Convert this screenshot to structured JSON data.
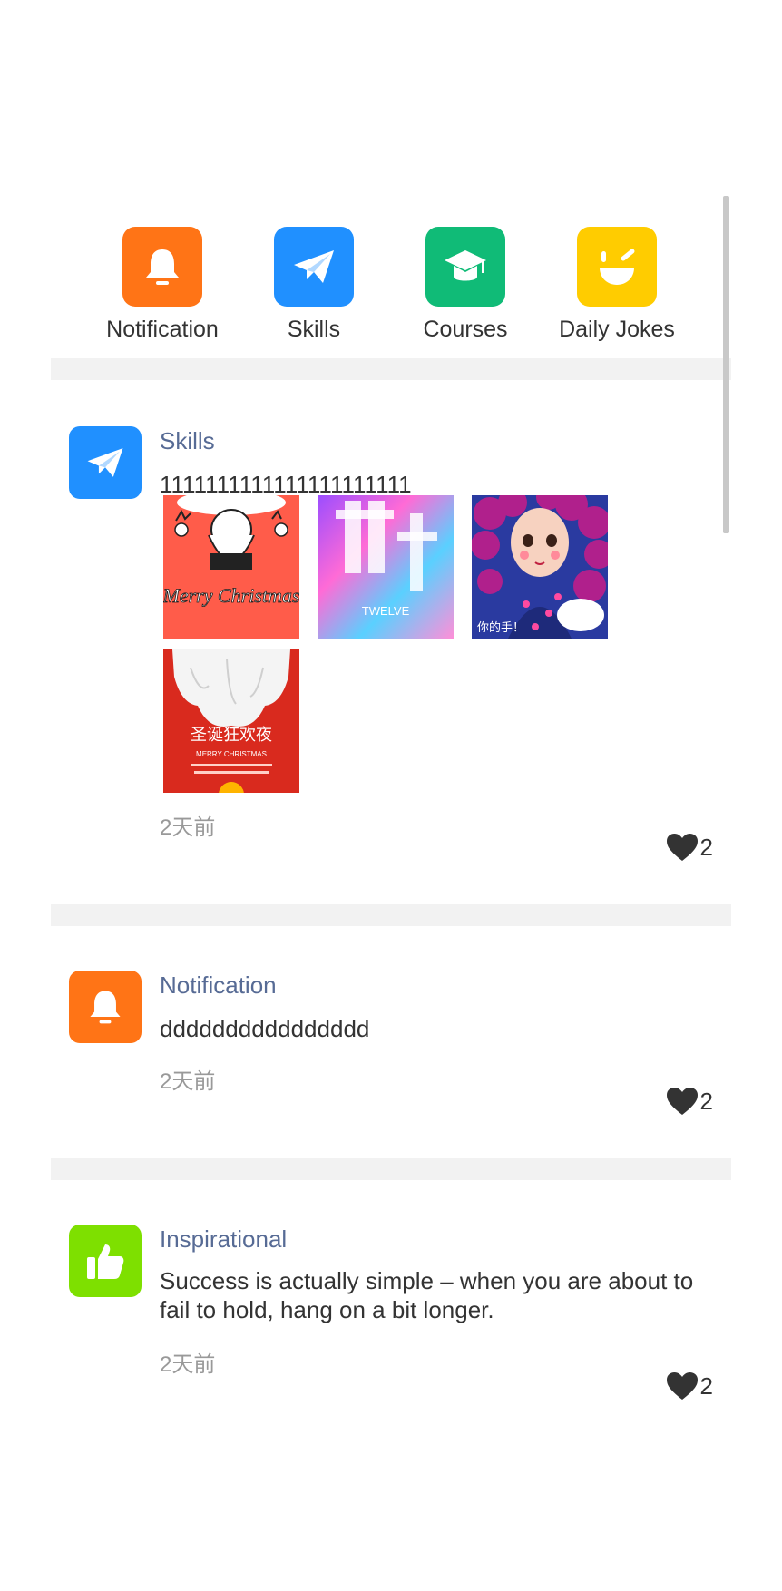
{
  "categories": [
    {
      "label": "Notification",
      "icon": "bell-icon",
      "color": "#ff7416"
    },
    {
      "label": "Skills",
      "icon": "paper-plane-icon",
      "color": "#2090ff"
    },
    {
      "label": "Courses",
      "icon": "graduation-cap-icon",
      "color": "#10bb77"
    },
    {
      "label": "Daily Jokes",
      "icon": "wink-face-icon",
      "color": "#ffcc00"
    }
  ],
  "posts": [
    {
      "category": "Skills",
      "icon": "paper-plane-icon",
      "color": "#2090ff",
      "content": "1111111111111111111111",
      "images": [
        {
          "alt": "Merry Christmas poster",
          "text": "Merry Christmas"
        },
        {
          "alt": "Double 12 gradient poster",
          "text": "TWELVE"
        },
        {
          "alt": "Curly-haired girl illustration",
          "text": "你的手！"
        },
        {
          "alt": "Christmas carnival night poster",
          "text": "圣诞狂欢夜",
          "sub": "MERRY CHRISTMAS"
        }
      ],
      "time": "2天前",
      "likes": "2"
    },
    {
      "category": "Notification",
      "icon": "bell-icon",
      "color": "#ff7416",
      "content": "dddddddddddddddd",
      "time": "2天前",
      "likes": "2"
    },
    {
      "category": "Inspirational",
      "icon": "thumbs-up-icon",
      "color": "#7ee000",
      "content": "Success is actually simple – when you are about to fail to hold, hang on a bit longer.",
      "time": "2天前",
      "likes": "2"
    }
  ]
}
